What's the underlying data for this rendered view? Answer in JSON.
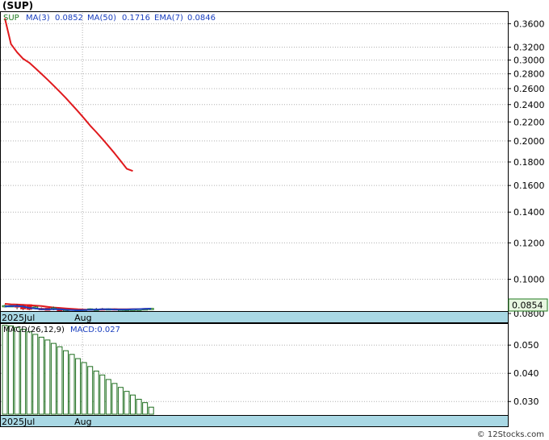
{
  "title": "(SUP)",
  "credit": "© 12Stocks.com",
  "colors": {
    "ma3": "#1a3fbf",
    "ma50": "#e0191d",
    "ema7": "#e0191d",
    "up_candle": "#1f7a1f",
    "down_candle": "#e0191d",
    "macd_bar": "#1f6e1f",
    "axis_band": "#a9d8e4",
    "grid": "#b0b0b0",
    "last_price_bg": "#e8f6e0"
  },
  "legend": {
    "symbol": "SUP",
    "ma3_label": "MA(3)",
    "ma3_value": "0.0852",
    "ma50_label": "MA(50)",
    "ma50_value": "0.1716",
    "ema7_label": "EMA(7)",
    "ema7_value": "0.0846"
  },
  "macd_legend": {
    "label": "MACD(26,12,9)",
    "value_label": "MACD:0.027"
  },
  "last_price": "0.0854",
  "chart_data": [
    {
      "type": "candlestick",
      "scale": "log",
      "ylim": [
        0.0856,
        0.38
      ],
      "yticks": [
        "0.3600",
        "0.3200",
        "0.3000",
        "0.2800",
        "0.2600",
        "0.2400",
        "0.2200",
        "0.2000",
        "0.1800",
        "0.1600",
        "0.1400",
        "0.1200",
        "0.1000",
        "0.0800"
      ],
      "x_labels": [
        {
          "label": "2025Jul",
          "index": 0
        },
        {
          "label": "Aug",
          "index": 13
        }
      ],
      "candles": [
        {
          "o": 0.0872,
          "h": 0.088,
          "l": 0.0868,
          "c": 0.0876
        },
        {
          "o": 0.0874,
          "h": 0.0878,
          "l": 0.087,
          "c": 0.0876
        },
        {
          "o": 0.0875,
          "h": 0.0882,
          "l": 0.086,
          "c": 0.0874
        },
        {
          "o": 0.0876,
          "h": 0.088,
          "l": 0.0856,
          "c": 0.0862
        },
        {
          "o": 0.088,
          "h": 0.0882,
          "l": 0.0856,
          "c": 0.086
        },
        {
          "o": 0.0866,
          "h": 0.0874,
          "l": 0.086,
          "c": 0.087
        },
        {
          "o": 0.0864,
          "h": 0.0868,
          "l": 0.0856,
          "c": 0.0858
        },
        {
          "o": 0.0865,
          "h": 0.0866,
          "l": 0.0856,
          "c": 0.0856
        },
        {
          "o": 0.086,
          "h": 0.0872,
          "l": 0.0856,
          "c": 0.0866
        },
        {
          "o": 0.0858,
          "h": 0.0862,
          "l": 0.0856,
          "c": 0.0856
        },
        {
          "o": 0.0856,
          "h": 0.086,
          "l": 0.0856,
          "c": 0.0858
        },
        {
          "o": 0.0856,
          "h": 0.0858,
          "l": 0.0856,
          "c": 0.0856
        },
        {
          "o": 0.0856,
          "h": 0.0858,
          "l": 0.0856,
          "c": 0.0857
        },
        {
          "o": 0.0856,
          "h": 0.0859,
          "l": 0.0856,
          "c": 0.0857
        },
        {
          "o": 0.0856,
          "h": 0.0864,
          "l": 0.0856,
          "c": 0.0862
        },
        {
          "o": 0.0856,
          "h": 0.0866,
          "l": 0.0856,
          "c": 0.086
        },
        {
          "o": 0.0862,
          "h": 0.0866,
          "l": 0.0856,
          "c": 0.0858
        },
        {
          "o": 0.0857,
          "h": 0.0864,
          "l": 0.0856,
          "c": 0.0862
        },
        {
          "o": 0.0862,
          "h": 0.0864,
          "l": 0.0856,
          "c": 0.0858
        },
        {
          "o": 0.0858,
          "h": 0.086,
          "l": 0.0856,
          "c": 0.0858
        },
        {
          "o": 0.0859,
          "h": 0.086,
          "l": 0.0856,
          "c": 0.0859
        },
        {
          "o": 0.086,
          "h": 0.0862,
          "l": 0.0858,
          "c": 0.086
        },
        {
          "o": 0.086,
          "h": 0.0862,
          "l": 0.0856,
          "c": 0.086
        },
        {
          "o": 0.0858,
          "h": 0.0864,
          "l": 0.0856,
          "c": 0.0862
        },
        {
          "o": 0.086,
          "h": 0.0866,
          "l": 0.0858,
          "c": 0.0864
        }
      ],
      "ma3": [
        0.0872,
        0.0874,
        0.0875,
        0.0872,
        0.0866,
        0.0864,
        0.086,
        0.086,
        0.0861,
        0.086,
        0.0858,
        0.0857,
        0.0856,
        0.0857,
        0.0858,
        0.0859,
        0.086,
        0.086,
        0.0859,
        0.0859,
        0.0859,
        0.086,
        0.0861,
        0.0862,
        0.0863
      ],
      "ema7": [
        0.0884,
        0.0882,
        0.0881,
        0.088,
        0.0878,
        0.0876,
        0.0874,
        0.0871,
        0.0868,
        0.0866,
        0.0864,
        0.0862,
        0.086,
        0.0859,
        0.0858,
        0.0859,
        0.0859,
        0.086,
        0.086,
        0.086,
        0.086,
        0.0861,
        0.0861,
        0.0862,
        0.0862
      ],
      "ma50": [
        0.37,
        0.325,
        0.312,
        0.302,
        0.296,
        0.288,
        0.28,
        0.272,
        0.264,
        0.256,
        0.248,
        0.24,
        0.232,
        0.224,
        0.216,
        0.209,
        0.202,
        0.195,
        0.188,
        0.181,
        0.174,
        0.172
      ]
    },
    {
      "type": "bar",
      "ylim": [
        0.0255,
        0.0572
      ],
      "yticks": [
        "0.050",
        "0.040",
        "0.030"
      ],
      "x_labels": [
        {
          "label": "2025Jul",
          "index": 0
        },
        {
          "label": "Aug",
          "index": 13
        }
      ],
      "values": [
        0.057,
        0.0568,
        0.0563,
        0.0556,
        0.0547,
        0.0538,
        0.0528,
        0.0518,
        0.0506,
        0.0494,
        0.048,
        0.0467,
        0.0452,
        0.0438,
        0.0424,
        0.0408,
        0.0394,
        0.0378,
        0.0364,
        0.035,
        0.0336,
        0.0323,
        0.0308,
        0.0296,
        0.028
      ]
    }
  ]
}
